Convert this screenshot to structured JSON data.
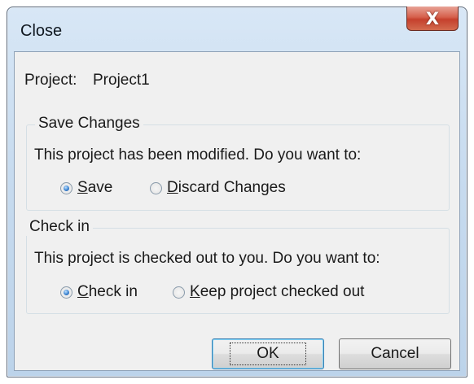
{
  "window": {
    "title": "Close",
    "close_glyph": "X"
  },
  "project": {
    "label": "Project:",
    "name": "Project1"
  },
  "save_changes": {
    "legend": "Save Changes",
    "prompt": "This project has been modified. Do you want to:",
    "options": [
      {
        "hotkey": "S",
        "rest": "ave",
        "selected": true
      },
      {
        "hotkey": "D",
        "rest": "iscard Changes",
        "selected": false
      }
    ]
  },
  "check_in": {
    "legend": "Check in",
    "prompt": "This project is checked out to you. Do you want to:",
    "options": [
      {
        "hotkey": "C",
        "rest": "heck in",
        "selected": true
      },
      {
        "hotkey": "K",
        "rest": "eep project checked out",
        "selected": false
      }
    ]
  },
  "buttons": {
    "ok": "OK",
    "cancel": "Cancel"
  },
  "colors": {
    "title_bar": "#c7dbef",
    "client_bg": "#f0f0f0",
    "close_button": "#c5402d",
    "radio_selected": "#3d84d1"
  }
}
